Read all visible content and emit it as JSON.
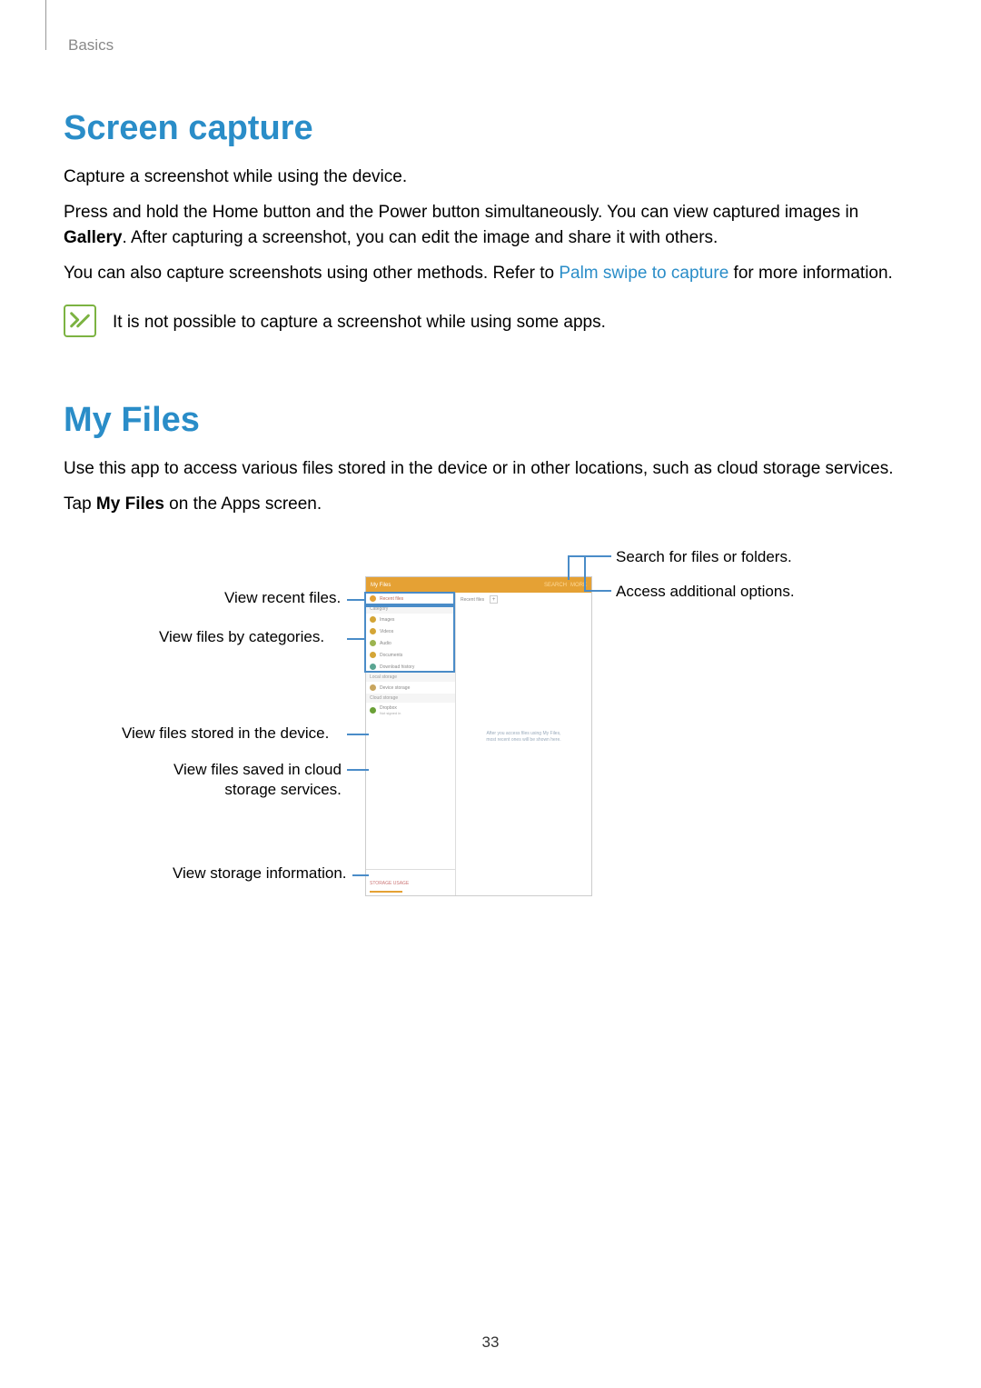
{
  "breadcrumb": "Basics",
  "section1": {
    "heading": "Screen capture",
    "p1": "Capture a screenshot while using the device.",
    "p2_pre": "Press and hold the Home button and the Power button simultaneously. You can view captured images in ",
    "p2_bold": "Gallery",
    "p2_post": ". After capturing a screenshot, you can edit the image and share it with others.",
    "p3_pre": "You can also capture screenshots using other methods. Refer to ",
    "p3_link": "Palm swipe to capture",
    "p3_post": " for more information.",
    "note": "It is not possible to capture a screenshot while using some apps."
  },
  "section2": {
    "heading": "My Files",
    "p1": "Use this app to access various files stored in the device or in other locations, such as cloud storage services.",
    "p2_pre": "Tap ",
    "p2_bold": "My Files",
    "p2_post": " on the Apps screen."
  },
  "callouts": {
    "search": "Search for files or folders.",
    "options": "Access additional options.",
    "recent": "View recent files.",
    "categories": "View files by categories.",
    "device": "View files stored in the device.",
    "cloud_line1": "View files saved in cloud",
    "cloud_line2": "storage services.",
    "storage": "View storage information."
  },
  "screenshot": {
    "header_title": "My Files",
    "header_search": "SEARCH",
    "header_more": "MORE",
    "sidebar": {
      "recent": "Recent files",
      "section_category": "Category",
      "images": "Images",
      "videos": "Videos",
      "audio": "Audio",
      "documents": "Documents",
      "download": "Download history",
      "section_local": "Local storage",
      "device": "Device storage",
      "section_cloud": "Cloud storage",
      "dropbox": "Dropbox",
      "dropbox_sub": "Not signed in",
      "storage_used": "STORAGE USAGE"
    },
    "content": {
      "tab1": "Recent files",
      "plus": "+",
      "msg_line1": "After you access files using My Files,",
      "msg_line2": "most recent ones will be shown here."
    }
  },
  "page_number": "33"
}
